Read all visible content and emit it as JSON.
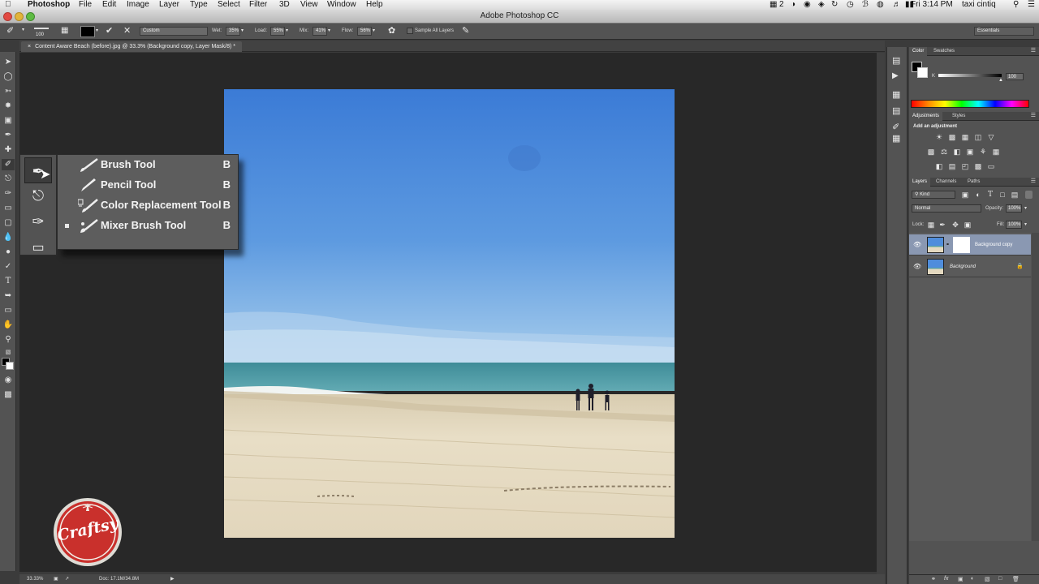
{
  "menubar": {
    "app": "Photoshop",
    "menus": [
      "File",
      "Edit",
      "Image",
      "Layer",
      "Type",
      "Select",
      "Filter",
      "3D",
      "View",
      "Window",
      "Help"
    ],
    "badge": "2",
    "clock": "Fri 3:14 PM",
    "user": "taxi cintiq"
  },
  "window": {
    "title": "Adobe Photoshop CC"
  },
  "options": {
    "brush_size": "100",
    "preset": "Custom",
    "wet_label": "Wet:",
    "wet_value": "35%",
    "load_label": "Load:",
    "load_value": "55%",
    "mix_label": "Mix:",
    "mix_value": "41%",
    "flow_label": "Flow:",
    "flow_value": "56%",
    "sample_all_layers": "Sample All Layers",
    "workspace": "Essentials"
  },
  "document": {
    "tab_title": "Content Aware Beach (before).jpg @ 33.3% (Background copy, Layer Mask/8) *"
  },
  "flyout": {
    "items": [
      {
        "label": "Brush Tool",
        "key": "B",
        "icon": "brush-icon",
        "selected": false
      },
      {
        "label": "Pencil Tool",
        "key": "B",
        "icon": "pencil-icon",
        "selected": false
      },
      {
        "label": "Color Replacement Tool",
        "key": "B",
        "icon": "color-replacement-icon",
        "selected": false
      },
      {
        "label": "Mixer Brush Tool",
        "key": "B",
        "icon": "mixer-brush-icon",
        "selected": true
      }
    ]
  },
  "status": {
    "zoom": "33.33%",
    "doc": "Doc: 17.1M/34.8M"
  },
  "watermark": {
    "text": "Craftsy"
  },
  "panels": {
    "color_tabs": [
      "Color",
      "Swatches"
    ],
    "slider_label": "K",
    "slider_value": "100",
    "adjust_tabs": [
      "Adjustments",
      "Styles"
    ],
    "adjust_hint": "Add an adjustment",
    "layers_tabs": [
      "Layers",
      "Channels",
      "Paths"
    ],
    "kind_filter": "Kind",
    "blend_mode": "Normal",
    "opacity_label": "Opacity:",
    "opacity_value": "100%",
    "lock_label": "Lock:",
    "fill_label": "Fill:",
    "fill_value": "100%",
    "layers": [
      {
        "name": "Background copy",
        "selected": true,
        "has_mask": true
      },
      {
        "name": "Background",
        "selected": false,
        "locked": true
      }
    ]
  },
  "colors": {
    "sky_top": "#3f7fd9",
    "sea": "#4a9aa0",
    "sand": "#e6dcc6",
    "panel": "#535353",
    "selection": "#8a98b2",
    "craftsy_red": "#c9302c"
  }
}
